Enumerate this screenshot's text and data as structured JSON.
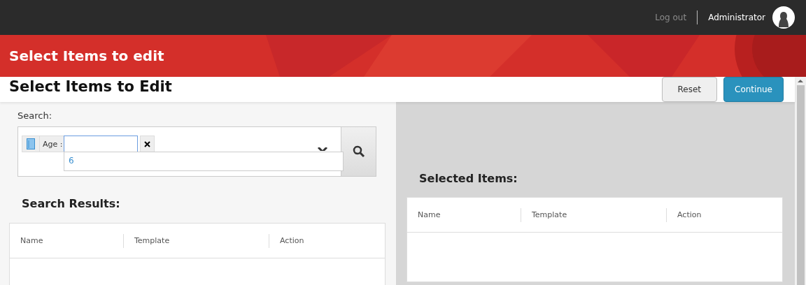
{
  "topbar": {
    "logout": "Log out",
    "user": "Administrator"
  },
  "banner": {
    "title": "Select Items to edit"
  },
  "header": {
    "title": "Select Items to Edit",
    "buttons": [
      {
        "label": "Reset",
        "kind": "secondary"
      },
      {
        "label": "Continue",
        "kind": "primary"
      }
    ]
  },
  "search": {
    "label": "Search:",
    "filter": {
      "label": "Age :",
      "focused": true
    },
    "suggestions": [
      "6"
    ]
  },
  "results": {
    "title": "Search Results:",
    "columns": [
      "Name",
      "Template",
      "Action"
    ]
  },
  "selected": {
    "title": "Selected Items:",
    "columns": [
      "Name",
      "Template",
      "Action"
    ]
  }
}
